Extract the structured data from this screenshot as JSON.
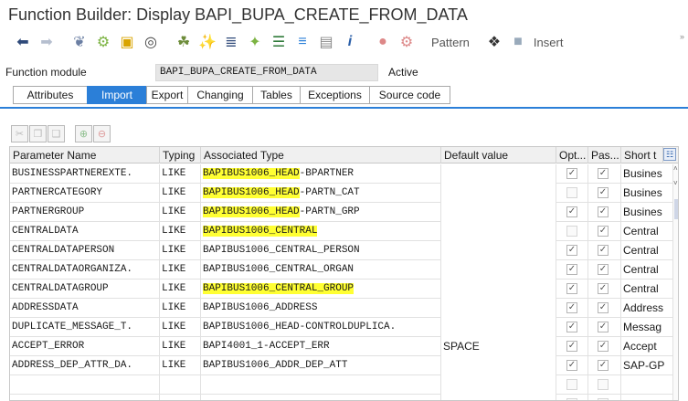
{
  "window": {
    "title": "Function Builder: Display BAPI_BUPA_CREATE_FROM_DATA"
  },
  "toolbar": {
    "pattern_label": "Pattern",
    "insert_label": "Insert",
    "more_label": "»"
  },
  "function_module": {
    "label": "Function module",
    "value": "BAPI_BUPA_CREATE_FROM_DATA",
    "status": "Active"
  },
  "tabs": [
    {
      "label": "Attributes"
    },
    {
      "label": "Import"
    },
    {
      "label": "Export"
    },
    {
      "label": "Changing"
    },
    {
      "label": "Tables"
    },
    {
      "label": "Exceptions"
    },
    {
      "label": "Source code"
    }
  ],
  "grid": {
    "headers": {
      "param": "Parameter Name",
      "typing": "Typing",
      "assoc": "Associated Type",
      "default": "Default value",
      "optional": "Opt...",
      "pass": "Pas...",
      "short": "Short t"
    },
    "rows": [
      {
        "param": "BUSINESSPARTNEREXTE.",
        "typing": "LIKE",
        "assoc_hl": "BAPIBUS1006_HEAD",
        "assoc_rest": "-BPARTNER",
        "default": "",
        "optional": "✓",
        "pass": "✓",
        "short": "Busines"
      },
      {
        "param": "PARTNERCATEGORY",
        "typing": "LIKE",
        "assoc_hl": "BAPIBUS1006_HEAD",
        "assoc_rest": "-PARTN_CAT",
        "default": "",
        "optional": "",
        "pass": "✓",
        "short": "Busines"
      },
      {
        "param": "PARTNERGROUP",
        "typing": "LIKE",
        "assoc_hl": "BAPIBUS1006_HEAD",
        "assoc_rest": "-PARTN_GRP",
        "default": "",
        "optional": "✓",
        "pass": "✓",
        "short": "Busines"
      },
      {
        "param": "CENTRALDATA",
        "typing": "LIKE",
        "assoc_hl": "BAPIBUS1006_CENTRAL",
        "assoc_rest": "",
        "default": "",
        "optional": "",
        "pass": "✓",
        "short": "Central"
      },
      {
        "param": "CENTRALDATAPERSON",
        "typing": "LIKE",
        "assoc_hl": "",
        "assoc_rest": "BAPIBUS1006_CENTRAL_PERSON",
        "default": "",
        "optional": "✓",
        "pass": "✓",
        "short": "Central"
      },
      {
        "param": "CENTRALDATAORGANIZA.",
        "typing": "LIKE",
        "assoc_hl": "",
        "assoc_rest": "BAPIBUS1006_CENTRAL_ORGAN",
        "default": "",
        "optional": "✓",
        "pass": "✓",
        "short": "Central"
      },
      {
        "param": "CENTRALDATAGROUP",
        "typing": "LIKE",
        "assoc_hl": "BAPIBUS1006_CENTRAL_GROUP",
        "assoc_rest": "",
        "default": "",
        "optional": "✓",
        "pass": "✓",
        "short": "Central"
      },
      {
        "param": "ADDRESSDATA",
        "typing": "LIKE",
        "assoc_hl": "",
        "assoc_rest": "BAPIBUS1006_ADDRESS",
        "default": "",
        "optional": "✓",
        "pass": "✓",
        "short": "Address"
      },
      {
        "param": "DUPLICATE_MESSAGE_T.",
        "typing": "LIKE",
        "assoc_hl": "",
        "assoc_rest": "BAPIBUS1006_HEAD-CONTROLDUPLICA.",
        "default": "",
        "optional": "✓",
        "pass": "✓",
        "short": "Messag"
      },
      {
        "param": "ACCEPT_ERROR",
        "typing": "LIKE",
        "assoc_hl": "",
        "assoc_rest": "BAPI4001_1-ACCEPT_ERR",
        "default": "SPACE",
        "optional": "✓",
        "pass": "✓",
        "short": "Accept"
      },
      {
        "param": "ADDRESS_DEP_ATTR_DA.",
        "typing": "LIKE",
        "assoc_hl": "",
        "assoc_rest": "BAPIBUS1006_ADDR_DEP_ATT",
        "default": "",
        "optional": "✓",
        "pass": "✓",
        "short": "SAP-GP"
      },
      {
        "param": "",
        "typing": "",
        "assoc_hl": "",
        "assoc_rest": "",
        "default": "",
        "optional": "",
        "pass": "",
        "short": ""
      },
      {
        "param": "",
        "typing": "",
        "assoc_hl": "",
        "assoc_rest": "",
        "default": "",
        "optional": "",
        "pass": "",
        "short": ""
      }
    ]
  },
  "colors": {
    "accent": "#2b7fd8",
    "highlight": "#ffff33"
  }
}
